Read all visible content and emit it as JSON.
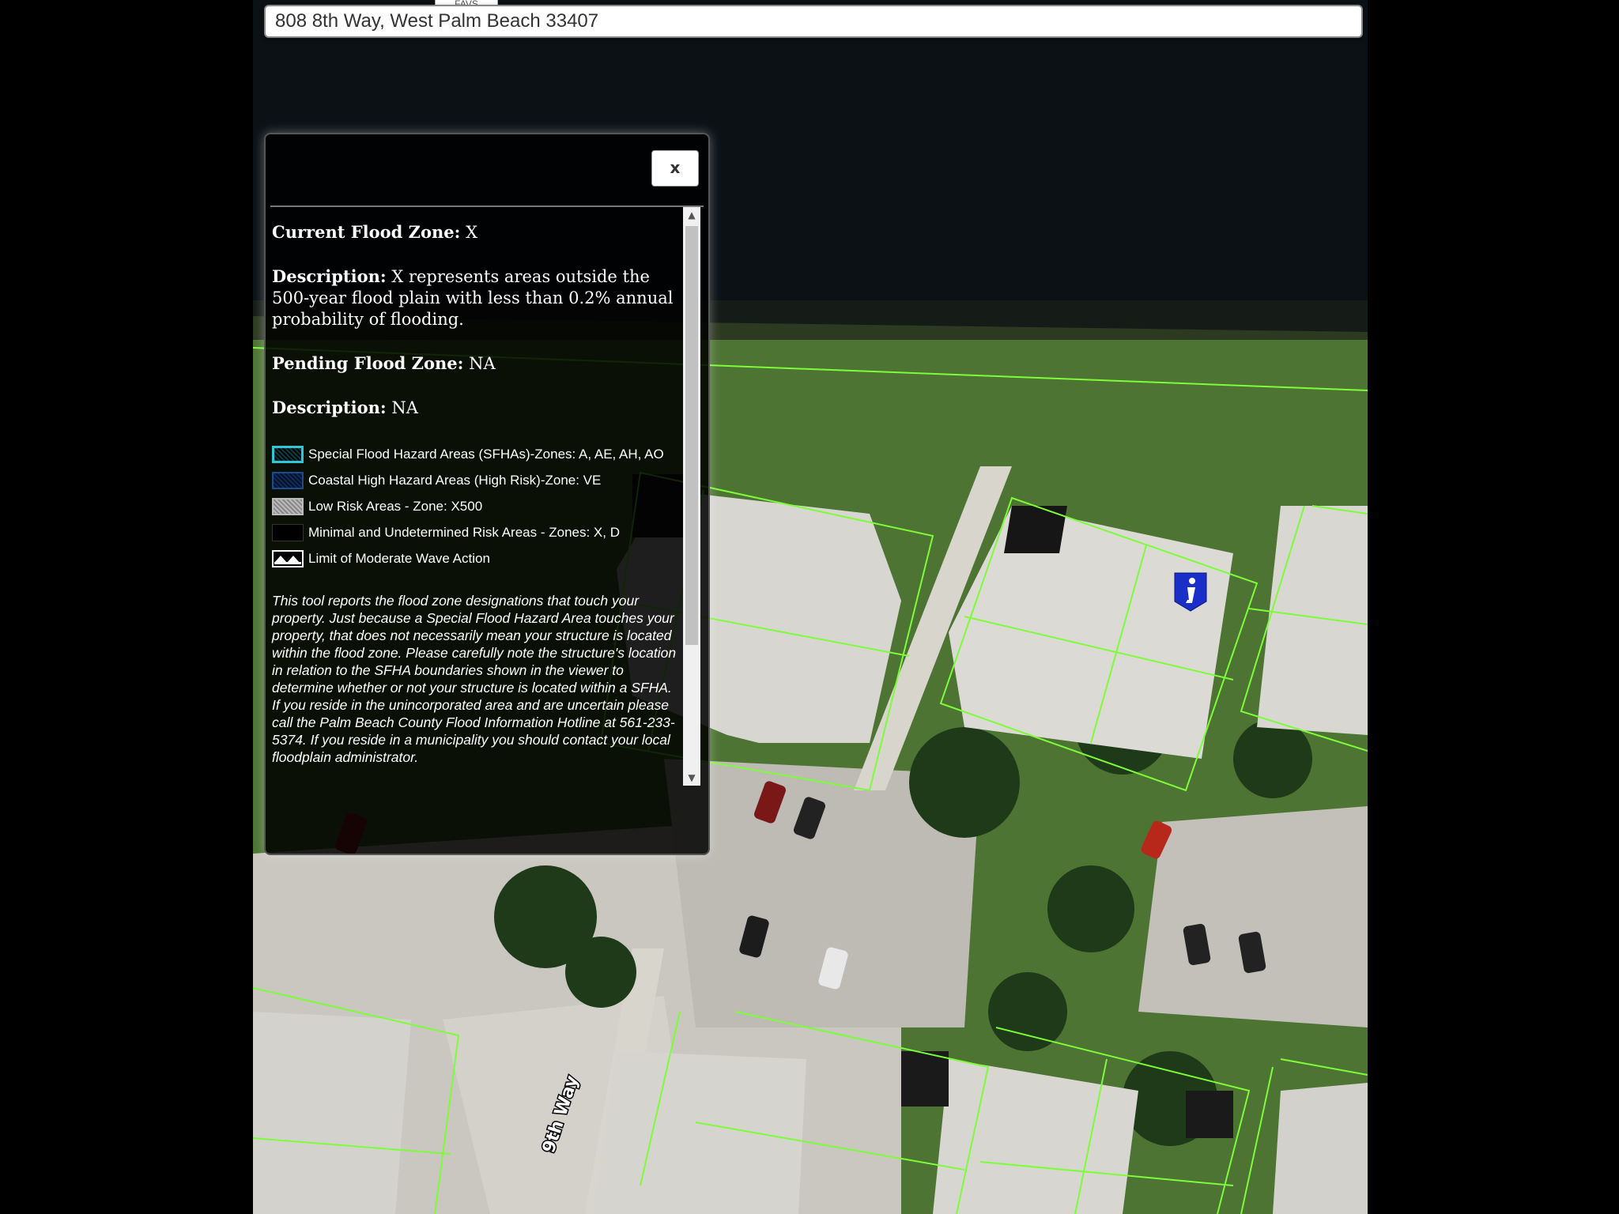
{
  "search": {
    "tab_label": "FAVS",
    "address": "808 8th Way, West Palm Beach 33407"
  },
  "popup": {
    "close_label": "x",
    "current_zone_label": "Current Flood Zone:",
    "current_zone_value": "X",
    "description_label": "Description:",
    "description_value": "X represents areas outside the 500-year flood plain with less than 0.2% annual probability of flooding.",
    "pending_zone_label": "Pending Flood Zone:",
    "pending_zone_value": "NA",
    "pending_description_label": "Description:",
    "pending_description_value": "NA",
    "legend": [
      {
        "label": "Special Flood Hazard Areas (SFHAs)-Zones: A, AE, AH, AO",
        "icon": "sfha-swatch-icon"
      },
      {
        "label": "Coastal High Hazard Areas (High Risk)-Zone: VE",
        "icon": "coastal-swatch-icon"
      },
      {
        "label": "Low Risk Areas - Zone: X500",
        "icon": "low-risk-swatch-icon"
      },
      {
        "label": "Minimal and Undetermined Risk Areas - Zones: X, D",
        "icon": "minimal-swatch-icon"
      },
      {
        "label": "Limit of Moderate Wave Action",
        "icon": "wave-action-icon"
      }
    ],
    "disclaimer": "This tool reports the flood zone designations that touch your property. Just because a Special Flood Hazard Area touches your property, that does not necessarily mean your structure is located within the flood zone. Please carefully note the structure's location in relation to the SFHA boundaries shown in the viewer to determine whether or not your structure is located within a SFHA. If you reside in the unincorporated area and are uncertain please call the Palm Beach County Flood Information Hotline at 561-233-5374. If you reside in a municipality you should contact your local floodplain administrator."
  },
  "map": {
    "street_label": "9th Way",
    "marker_icon": "info-marker-icon",
    "parcel_line_color": "#7dfc3a",
    "water_color": "#0b0f14",
    "grass_color": "#4f7a36"
  }
}
